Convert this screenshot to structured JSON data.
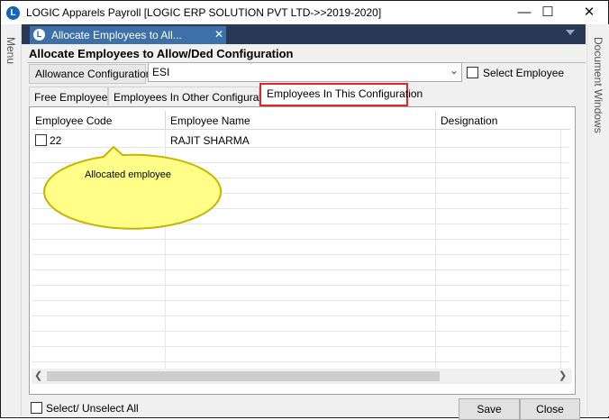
{
  "window": {
    "title": "LOGIC Apparels Payroll  [LOGIC ERP SOLUTION PVT LTD->>2019-2020]",
    "app_icon_letter": "L",
    "minimize": "—",
    "maximize": "☐",
    "close": "✕"
  },
  "left_panel": {
    "label": "Menu"
  },
  "right_panel": {
    "label": "Document Windows"
  },
  "doc_tab": {
    "label": "Allocate Employees to All...",
    "close": "✕"
  },
  "form": {
    "title": "Allocate Employees to Allow/Ded Configuration",
    "allowance_label": "Allowance Configuration",
    "allowance_value": "ESI",
    "select_employee_label": "Select Employee",
    "select_employee_checked": false
  },
  "tabs": [
    {
      "label": "Free Employees",
      "active": false
    },
    {
      "label": "Employees In Other Configuration",
      "active": false
    },
    {
      "label": "Employees In This Configuration",
      "active": true
    }
  ],
  "grid": {
    "columns": [
      "Employee Code",
      "Employee Name",
      "Designation"
    ],
    "rows": [
      {
        "code": "22",
        "name": "RAJIT SHARMA",
        "designation": "",
        "checked": false
      }
    ]
  },
  "callout": {
    "text": "Allocated  employee",
    "fill_color": "#ffff88",
    "border_color": "#c8b400"
  },
  "footer": {
    "select_all_label": "Select/ Unselect All",
    "save_label": "Save",
    "close_label": "Close"
  },
  "colors": {
    "doc_strip": "#293955",
    "active_doc_tab": "#3d6fa8",
    "active_tab_border": "#e0262a"
  }
}
